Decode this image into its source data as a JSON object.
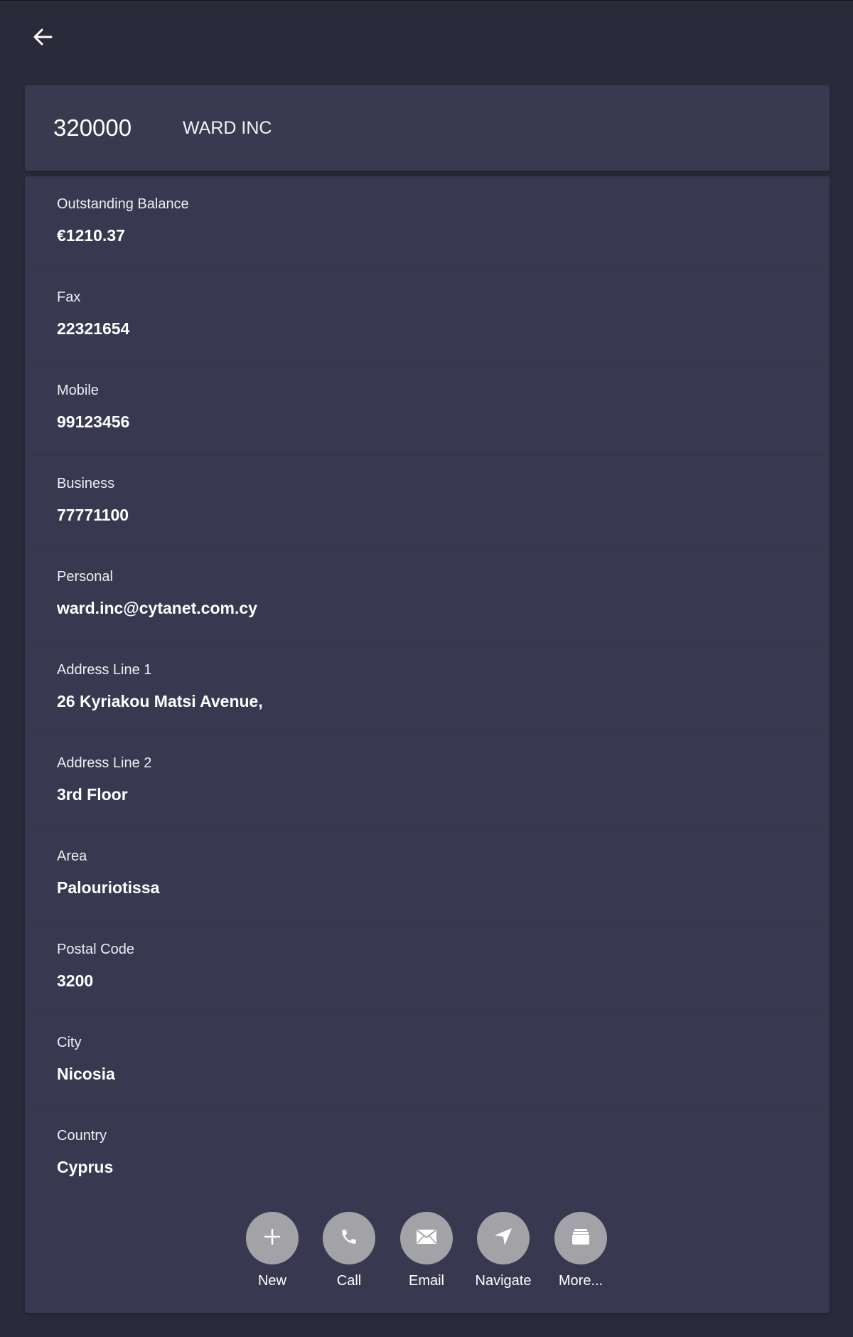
{
  "header": {
    "back_icon": "arrow-left-icon",
    "account_code": "320000",
    "account_name": "WARD INC"
  },
  "fields": [
    {
      "label": "Outstanding Balance",
      "value": "€1210.37"
    },
    {
      "label": "Fax",
      "value": "22321654"
    },
    {
      "label": "Mobile",
      "value": "99123456"
    },
    {
      "label": "Business",
      "value": "77771100"
    },
    {
      "label": "Personal",
      "value": "ward.inc@cytanet.com.cy"
    },
    {
      "label": "Address Line 1",
      "value": "26 Kyriakou Matsi Avenue,"
    },
    {
      "label": "Address Line 2",
      "value": "3rd Floor"
    },
    {
      "label": "Area",
      "value": "Palouriotissa"
    },
    {
      "label": "Postal Code",
      "value": "3200"
    },
    {
      "label": "City",
      "value": "Nicosia"
    },
    {
      "label": "Country",
      "value": "Cyprus"
    }
  ],
  "actions": [
    {
      "label": "New",
      "icon": "plus-icon"
    },
    {
      "label": "Call",
      "icon": "phone-icon"
    },
    {
      "label": "Email",
      "icon": "envelope-icon"
    },
    {
      "label": "Navigate",
      "icon": "navigation-arrow-icon"
    },
    {
      "label": "More...",
      "icon": "box-icon"
    }
  ],
  "colors": {
    "background": "#2a2a3b",
    "card": "#383950",
    "action_button": "#a3a3a7",
    "text": "#ffffff"
  }
}
